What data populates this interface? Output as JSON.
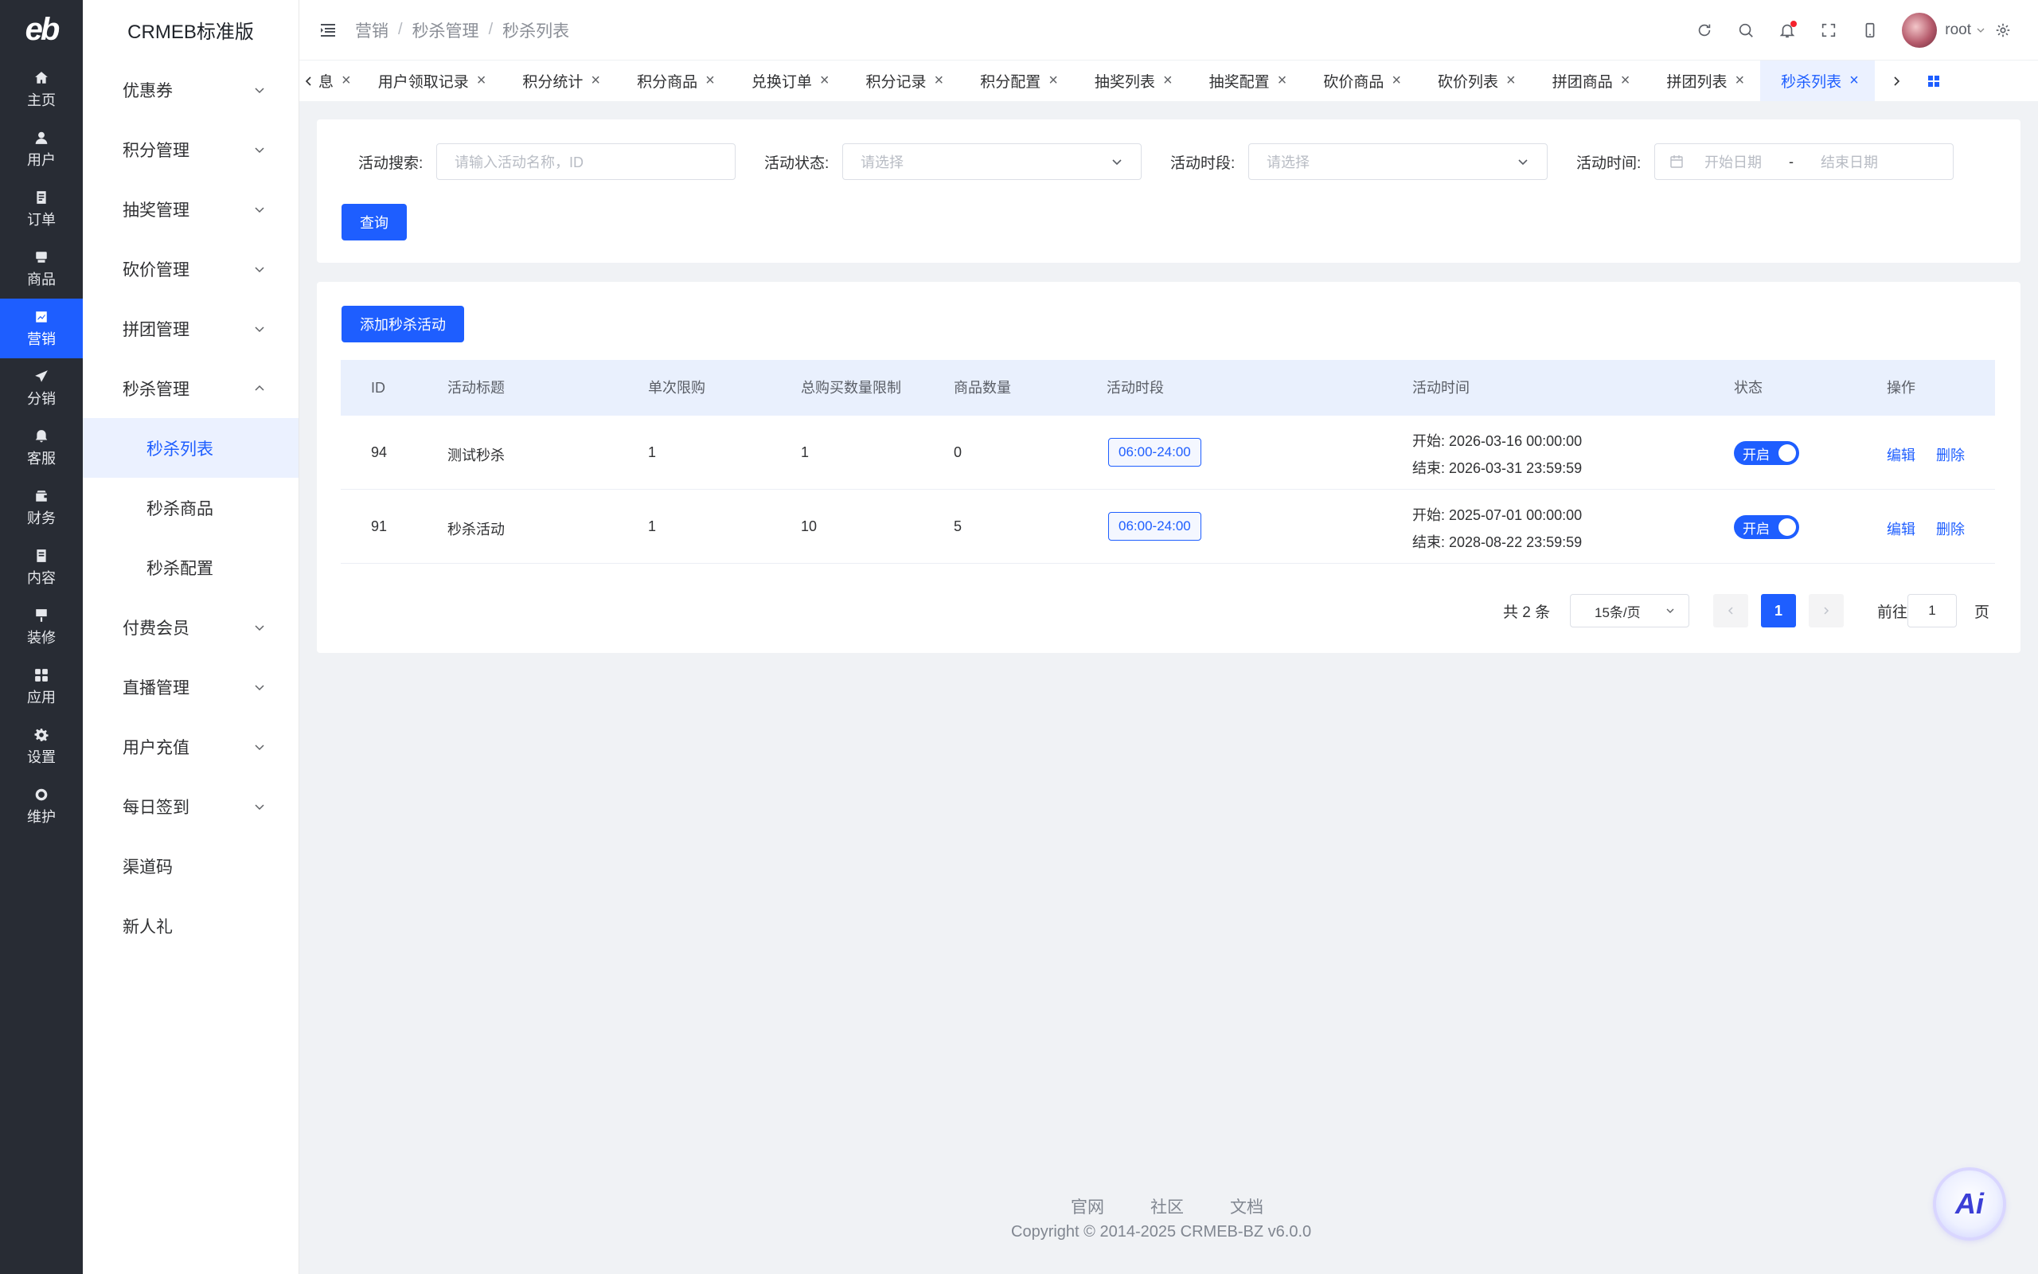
{
  "rail": {
    "logo": "eb",
    "items": [
      {
        "label": "主页",
        "icon": "home-icon"
      },
      {
        "label": "用户",
        "icon": "user-icon"
      },
      {
        "label": "订单",
        "icon": "order-icon"
      },
      {
        "label": "商品",
        "icon": "product-icon"
      },
      {
        "label": "营销",
        "icon": "marketing-icon"
      },
      {
        "label": "分销",
        "icon": "distribution-icon"
      },
      {
        "label": "客服",
        "icon": "service-icon"
      },
      {
        "label": "财务",
        "icon": "finance-icon"
      },
      {
        "label": "内容",
        "icon": "content-icon"
      },
      {
        "label": "装修",
        "icon": "decoration-icon"
      },
      {
        "label": "应用",
        "icon": "apps-icon"
      },
      {
        "label": "设置",
        "icon": "settings-icon"
      },
      {
        "label": "维护",
        "icon": "maintenance-icon"
      }
    ],
    "active": "营销"
  },
  "sidebar": {
    "title": "CRMEB标准版",
    "items": [
      {
        "label": "优惠券"
      },
      {
        "label": "积分管理"
      },
      {
        "label": "抽奖管理"
      },
      {
        "label": "砍价管理"
      },
      {
        "label": "拼团管理"
      },
      {
        "label": "秒杀管理"
      },
      {
        "label": "秒杀列表"
      },
      {
        "label": "秒杀商品"
      },
      {
        "label": "秒杀配置"
      },
      {
        "label": "付费会员"
      },
      {
        "label": "直播管理"
      },
      {
        "label": "用户充值"
      },
      {
        "label": "每日签到"
      },
      {
        "label": "渠道码"
      },
      {
        "label": "新人礼"
      }
    ]
  },
  "header": {
    "breadcrumb": [
      "营销",
      "秒杀管理",
      "秒杀列表"
    ],
    "separator": "/",
    "username": "root"
  },
  "tabs": {
    "partial_label": "息",
    "items": [
      {
        "label": "用户领取记录"
      },
      {
        "label": "积分统计"
      },
      {
        "label": "积分商品"
      },
      {
        "label": "兑换订单"
      },
      {
        "label": "积分记录"
      },
      {
        "label": "积分配置"
      },
      {
        "label": "抽奖列表"
      },
      {
        "label": "抽奖配置"
      },
      {
        "label": "砍价商品"
      },
      {
        "label": "砍价列表"
      },
      {
        "label": "拼团商品"
      },
      {
        "label": "拼团列表"
      },
      {
        "label": "秒杀列表"
      }
    ],
    "active": "秒杀列表",
    "close_glyph": "×"
  },
  "filters": {
    "search_label": "活动搜索:",
    "search_placeholder": "请输入活动名称，ID",
    "status_label": "活动状态:",
    "status_placeholder": "请选择",
    "period_label": "活动时段:",
    "period_placeholder": "请选择",
    "time_label": "活动时间:",
    "start_placeholder": "开始日期",
    "range_sep": "-",
    "end_placeholder": "结束日期",
    "query_button": "查询"
  },
  "table": {
    "add_button": "添加秒杀活动",
    "columns": [
      "ID",
      "活动标题",
      "单次限购",
      "总购买数量限制",
      "商品数量",
      "活动时段",
      "活动时间",
      "状态",
      "操作"
    ],
    "rows": [
      {
        "id": "94",
        "title": "测试秒杀",
        "once_limit": "1",
        "total_limit": "1",
        "goods_count": "0",
        "period": "06:00-24:00",
        "start": "开始: 2026-03-16 00:00:00",
        "end": "结束: 2026-03-31 23:59:59",
        "status": "开启",
        "status_on": true,
        "edit": "编辑",
        "delete": "删除"
      },
      {
        "id": "91",
        "title": "秒杀活动",
        "once_limit": "1",
        "total_limit": "10",
        "goods_count": "5",
        "period": "06:00-24:00",
        "start": "开始: 2025-07-01 00:00:00",
        "end": "结束: 2028-08-22 23:59:59",
        "status": "开启",
        "status_on": true,
        "edit": "编辑",
        "delete": "删除"
      }
    ]
  },
  "pagination": {
    "total": "共 2 条",
    "page_size": "15条/页",
    "current_page": "1",
    "goto_label": "前往",
    "goto_value": "1",
    "page_suffix": "页"
  },
  "footer": {
    "links": [
      "官网",
      "社区",
      "文档"
    ],
    "copyright": "Copyright © 2014-2025 CRMEB-BZ v6.0.0"
  },
  "ai_button": "Ai",
  "colors": {
    "primary": "#1e5eff",
    "rail_bg": "#282c34",
    "active_bg": "#ebf1ff"
  }
}
